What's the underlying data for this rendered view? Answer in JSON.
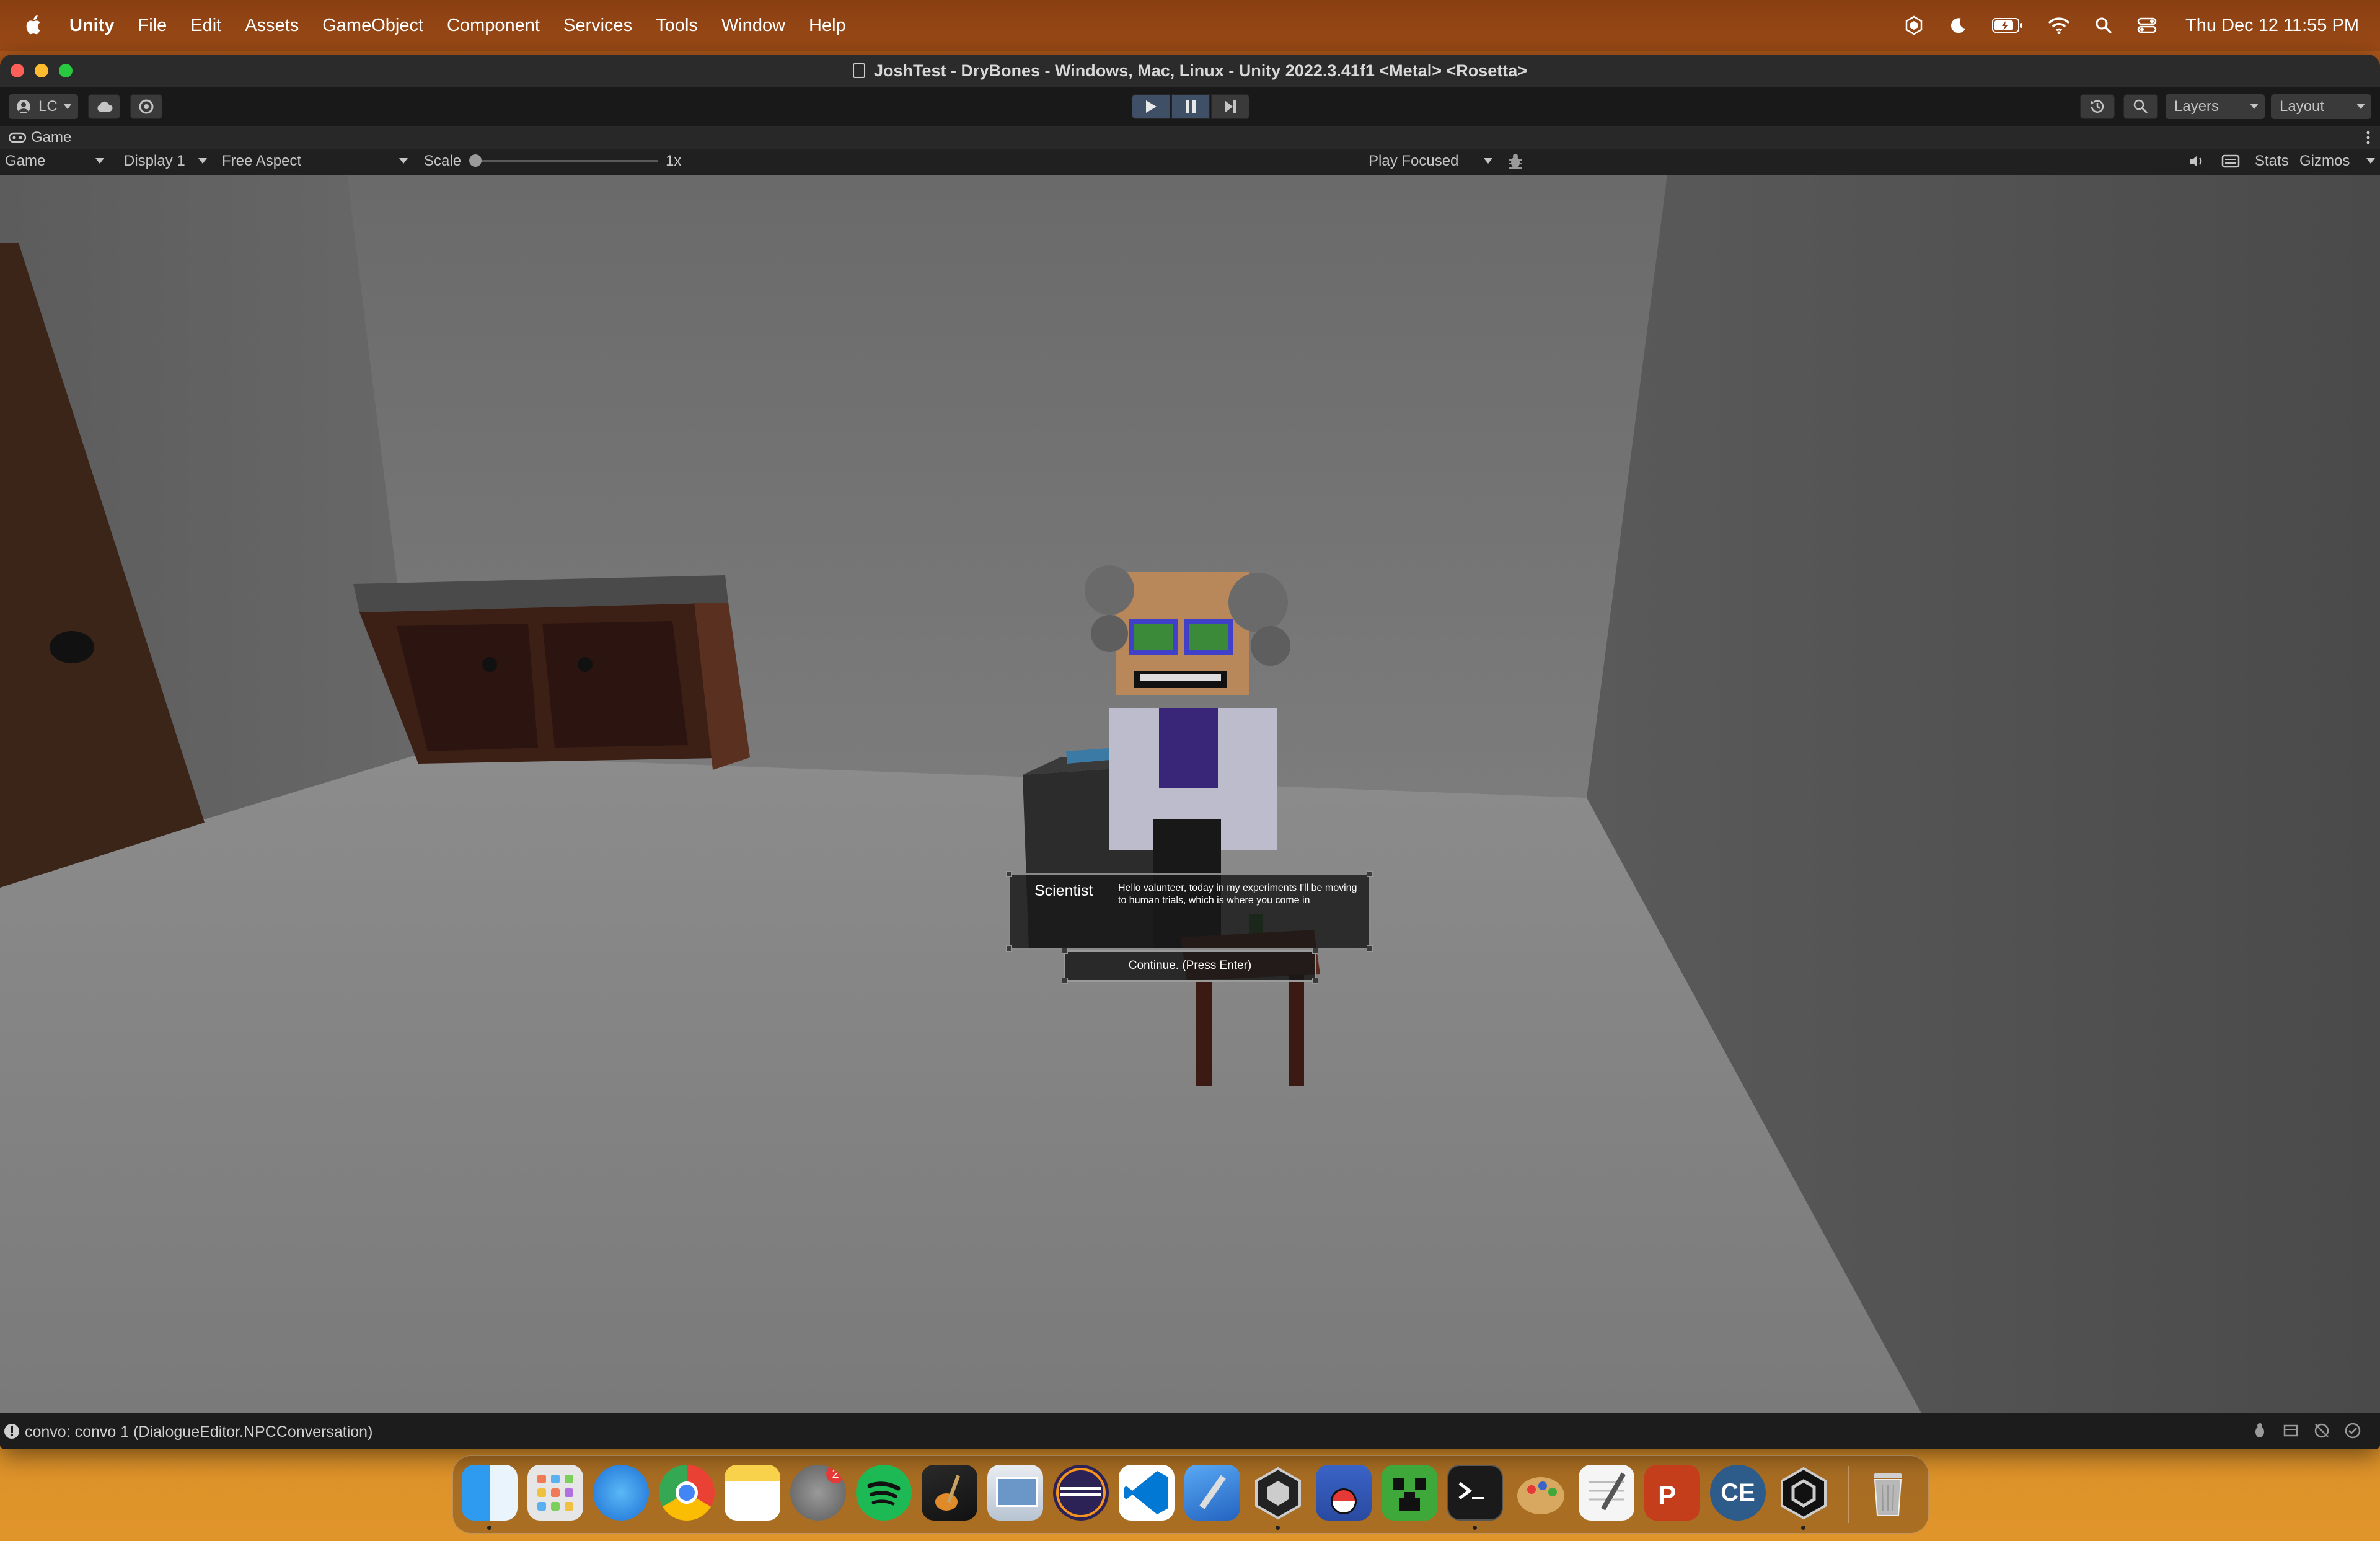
{
  "menubar": {
    "app_name": "Unity",
    "items": [
      "File",
      "Edit",
      "Assets",
      "GameObject",
      "Component",
      "Services",
      "Tools",
      "Window",
      "Help"
    ],
    "clock": "Thu Dec 12  11:55 PM",
    "status_icons": [
      "unity-icon",
      "moon-icon",
      "battery-icon",
      "wifi-icon",
      "search-icon",
      "control-center-icon"
    ]
  },
  "window": {
    "title": "JoshTest - DryBones - Windows, Mac, Linux - Unity 2022.3.41f1 <Metal> <Rosetta>"
  },
  "toolbar": {
    "account_label": "LC",
    "layers_label": "Layers",
    "layout_label": "Layout"
  },
  "tab": {
    "label": "Game"
  },
  "game_controls": {
    "view_mode": "Game",
    "display": "Display 1",
    "aspect": "Free Aspect",
    "scale_label": "Scale",
    "scale_value": "1x",
    "scale_fraction": 0,
    "play_mode": "Play Focused",
    "stats_label": "Stats",
    "gizmos_label": "Gizmos"
  },
  "dialogue": {
    "speaker": "Scientist",
    "text": "Hello valunteer, today in my experiments I'll be moving to human trials, which is where you come in",
    "continue_label": "Continue. (Press Enter)"
  },
  "statusbar": {
    "message": "convo: convo 1 (DialogueEditor.NPCConversation)"
  },
  "dock": {
    "apps": [
      "finder-icon",
      "launchpad-icon",
      "safari-icon",
      "chrome-icon",
      "notes-icon",
      "system-settings-icon",
      "spotify-icon",
      "garageband-icon",
      "preview-icon",
      "eclipse-icon",
      "vscode-icon",
      "xcode-icon",
      "unity-hub-icon",
      "pokemon-icon",
      "minecraft-icon",
      "terminal-icon",
      "paintbrush-icon",
      "textedit-icon",
      "powerpoint-icon",
      "cheat-engine-icon",
      "unity-icon",
      "trash-icon"
    ],
    "badge": "2",
    "ce_label": "CE"
  }
}
